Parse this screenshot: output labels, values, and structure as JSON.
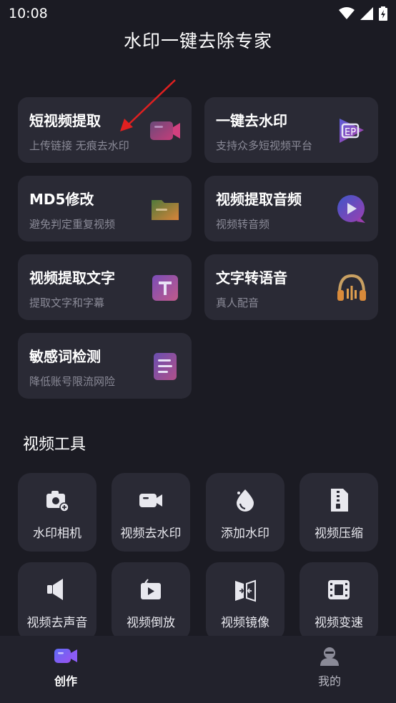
{
  "status_bar": {
    "time": "10:08"
  },
  "app_title": "水印一键去除专家",
  "feature_cards": [
    {
      "title": "短视频提取",
      "subtitle": "上传链接 无痕去水印",
      "icon": "video-camera-icon"
    },
    {
      "title": "一键去水印",
      "subtitle": "支持众多短视频平台",
      "icon": "eraser-icon"
    },
    {
      "title": "MD5修改",
      "subtitle": "避免判定重复视频",
      "icon": "folder-icon"
    },
    {
      "title": "视频提取音频",
      "subtitle": "视频转音频",
      "icon": "play-bubble-icon"
    },
    {
      "title": "视频提取文字",
      "subtitle": "提取文字和字幕",
      "icon": "text-t-icon"
    },
    {
      "title": "文字转语音",
      "subtitle": "真人配音",
      "icon": "headphones-icon"
    },
    {
      "title": "敏感词检测",
      "subtitle": "降低账号限流网险",
      "icon": "document-list-icon"
    }
  ],
  "tools_section": {
    "title": "视频工具",
    "items": [
      {
        "label": "水印相机",
        "icon": "camera-plus-icon"
      },
      {
        "label": "视频去水印",
        "icon": "video-icon"
      },
      {
        "label": "添加水印",
        "icon": "water-drop-icon"
      },
      {
        "label": "视频压缩",
        "icon": "zip-file-icon"
      },
      {
        "label": "视频去声音",
        "icon": "mute-speaker-icon"
      },
      {
        "label": "视频倒放",
        "icon": "reverse-play-icon"
      },
      {
        "label": "视频镜像",
        "icon": "mirror-icon"
      },
      {
        "label": "视频变速",
        "icon": "film-speed-icon"
      }
    ]
  },
  "bottom_nav": {
    "items": [
      {
        "label": "创作",
        "icon": "create-video-icon",
        "active": true
      },
      {
        "label": "我的",
        "icon": "profile-icon",
        "active": false
      }
    ]
  },
  "colors": {
    "background": "#1b1b23",
    "card": "#2a2a35",
    "accent": "#6b5cf6",
    "subtitle": "#8a8a97"
  }
}
